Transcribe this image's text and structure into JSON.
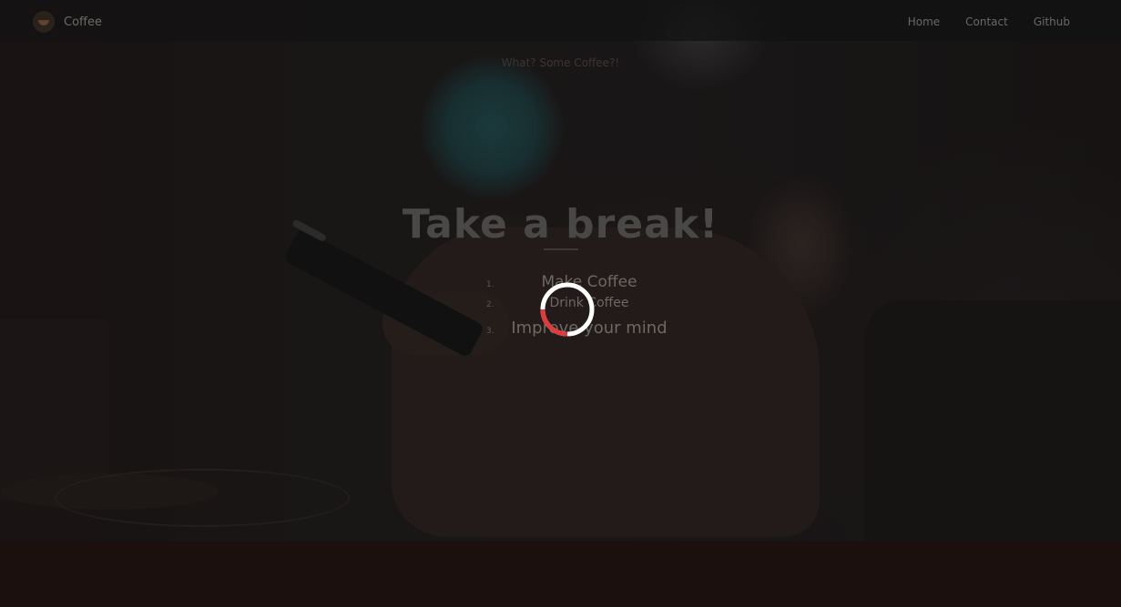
{
  "navbar": {
    "brand": "Coffee",
    "links": [
      "Home",
      "Contact",
      "Github"
    ]
  },
  "hero": {
    "title": "Take a break!",
    "steps": [
      {
        "num": "1.",
        "text": "Make Coffee"
      },
      {
        "num": "2.",
        "text": "Drink Coffee"
      },
      {
        "num": "3.",
        "text": "Improve your mind"
      }
    ]
  },
  "loader": {
    "icon": "loading-spinner-icon",
    "track_color": "#ffffff",
    "arc_color": "#e03a3a"
  },
  "footer": {
    "text": "What?     Some Coffee?!"
  },
  "colors": {
    "footer_bg": "#1c100f",
    "navbar_bg": "#121212"
  }
}
